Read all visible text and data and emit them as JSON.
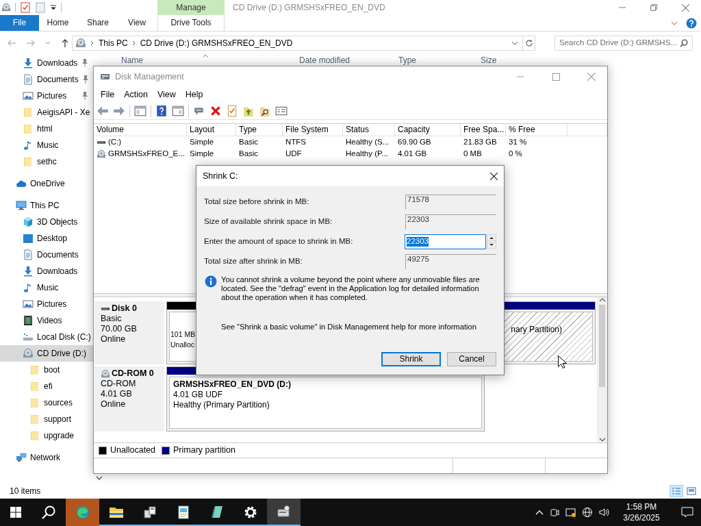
{
  "explorer": {
    "title": "CD Drive (D:) GRMSHSxFREO_EN_DVD",
    "context_label": "Manage",
    "file_tab": "File",
    "tabs": [
      "Home",
      "Share",
      "View"
    ],
    "context_tab": "Drive Tools",
    "breadcrumbs": [
      "This PC",
      "CD Drive (D:) GRMSHSxFREO_EN_DVD"
    ],
    "search": {
      "placeholder": "Search CD Drive (D:) GRMSHS..."
    },
    "columns": [
      "Name",
      "Date modified",
      "Type",
      "Size"
    ],
    "quick_access": [
      {
        "label": "Downloads",
        "kind": "download",
        "pinned": true,
        "selected": false
      },
      {
        "label": "Documents",
        "kind": "document",
        "pinned": true,
        "selected": false
      },
      {
        "label": "Pictures",
        "kind": "picture",
        "pinned": true,
        "selected": false
      },
      {
        "label": "AeigisAPI - Xe",
        "kind": "folder",
        "pinned": false,
        "selected": false
      },
      {
        "label": "html",
        "kind": "folder",
        "pinned": false,
        "selected": false
      },
      {
        "label": "Music",
        "kind": "music",
        "pinned": false,
        "selected": false
      },
      {
        "label": "sethc",
        "kind": "folder",
        "pinned": false,
        "selected": false
      }
    ],
    "nav": [
      {
        "label": "OneDrive",
        "kind": "cloud",
        "selected": false
      },
      {
        "label": "This PC",
        "kind": "pc",
        "selected": false,
        "children": [
          {
            "label": "3D Objects",
            "kind": "cube",
            "selected": false
          },
          {
            "label": "Desktop",
            "kind": "desktop",
            "selected": false
          },
          {
            "label": "Documents",
            "kind": "document",
            "selected": false
          },
          {
            "label": "Downloads",
            "kind": "download",
            "selected": false
          },
          {
            "label": "Music",
            "kind": "music",
            "selected": false
          },
          {
            "label": "Pictures",
            "kind": "picture",
            "selected": false
          },
          {
            "label": "Videos",
            "kind": "video",
            "selected": false
          },
          {
            "label": "Local Disk (C:)",
            "kind": "disk",
            "selected": false
          },
          {
            "label": "CD Drive (D:)",
            "kind": "cd",
            "selected": true,
            "children": [
              {
                "label": "boot",
                "kind": "folder",
                "selected": false
              },
              {
                "label": "efi",
                "kind": "folder",
                "selected": false
              },
              {
                "label": "sources",
                "kind": "folder",
                "selected": false
              },
              {
                "label": "support",
                "kind": "folder",
                "selected": false
              },
              {
                "label": "upgrade",
                "kind": "folder",
                "selected": false
              }
            ]
          }
        ]
      },
      {
        "label": "Network",
        "kind": "network",
        "selected": false
      }
    ],
    "status": "10 items"
  },
  "disk_management": {
    "title": "Disk Management",
    "menu": [
      "File",
      "Action",
      "View",
      "Help"
    ],
    "columns": [
      "Volume",
      "Layout",
      "Type",
      "File System",
      "Status",
      "Capacity",
      "Free Spa...",
      "% Free"
    ],
    "rows": [
      {
        "kind": "disk",
        "cells": [
          "(C:)",
          "Simple",
          "Basic",
          "NTFS",
          "Healthy (S...",
          "69.90 GB",
          "21.83 GB",
          "31 %"
        ]
      },
      {
        "kind": "cd",
        "cells": [
          "GRMSHSxFREO_E...",
          "Simple",
          "Basic",
          "UDF",
          "Healthy (P...",
          "4.01 GB",
          "0 MB",
          "0 %"
        ]
      }
    ],
    "disks": [
      {
        "kind": "disk",
        "name": "Disk 0",
        "lines": [
          "Basic",
          "70.00 GB",
          "Online"
        ],
        "partitions": [
          {
            "kind": "unallocated",
            "lines": [
              "101 MB",
              "Unalloc"
            ],
            "selected": false
          },
          {
            "kind": "primary",
            "lines": [
              "nary Partition)"
            ],
            "selected": true
          }
        ]
      },
      {
        "kind": "cd",
        "name": "CD-ROM 0",
        "lines": [
          "CD-ROM",
          "4.01 GB",
          "Online"
        ],
        "partitions": [
          {
            "kind": "primary",
            "title": "GRMSHSxFREO_EN_DVD  (D:)",
            "lines": [
              "4.01 GB UDF",
              "Healthy (Primary Partition)"
            ],
            "selected": false
          }
        ]
      }
    ],
    "legend": [
      {
        "label": "Unallocated",
        "color": "#000000"
      },
      {
        "label": "Primary partition",
        "color": "#000080"
      }
    ]
  },
  "dialog": {
    "title": "Shrink C:",
    "fields": [
      {
        "label": "Total size before shrink in MB:",
        "value": "71578",
        "kind": "readonly"
      },
      {
        "label": "Size of available shrink space in MB:",
        "value": "22303",
        "kind": "readonly"
      },
      {
        "label": "Enter the amount of space to shrink in MB:",
        "value": "22303",
        "kind": "spin"
      },
      {
        "label": "Total size after shrink in MB:",
        "value": "49275",
        "kind": "readonly"
      }
    ],
    "info": "You cannot shrink a volume beyond the point where any unmovable files are located. See the \"defrag\" event in the Application log for detailed information about the operation when it has completed.",
    "help": "See \"Shrink a basic volume\" in Disk Management help for more information",
    "buttons": [
      {
        "label": "Shrink",
        "default": true
      },
      {
        "label": "Cancel",
        "default": false
      }
    ]
  },
  "taskbar": {
    "apps": [
      {
        "kind": "edge",
        "flashing": true,
        "active": false,
        "running": false
      },
      {
        "kind": "folder",
        "flashing": false,
        "active": false,
        "running": true
      },
      {
        "kind": "boxes",
        "flashing": false,
        "active": false,
        "running": true
      },
      {
        "kind": "document",
        "flashing": false,
        "active": false,
        "running": true
      },
      {
        "kind": "notebook",
        "flashing": false,
        "active": false,
        "running": true
      },
      {
        "kind": "gear",
        "flashing": false,
        "active": false,
        "running": true
      },
      {
        "kind": "drive",
        "flashing": false,
        "active": true,
        "running": true
      }
    ],
    "time": "1:58 PM",
    "date": "3/26/2025"
  }
}
